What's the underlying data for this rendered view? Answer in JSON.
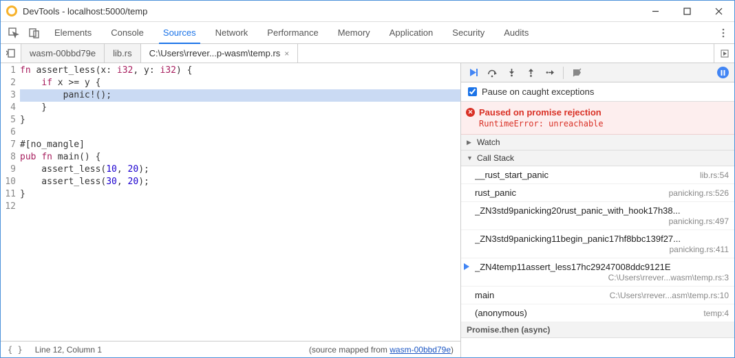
{
  "window": {
    "title": "DevTools - localhost:5000/temp"
  },
  "main_tabs": [
    "Elements",
    "Console",
    "Sources",
    "Network",
    "Performance",
    "Memory",
    "Application",
    "Security",
    "Audits"
  ],
  "main_tab_active": 2,
  "file_tabs": [
    {
      "label": "wasm-00bbd79e",
      "closable": false
    },
    {
      "label": "lib.rs",
      "closable": false
    },
    {
      "label": "C:\\Users\\rrever...p-wasm\\temp.rs",
      "closable": true
    }
  ],
  "file_tab_active": 2,
  "code": {
    "highlight_line": 3,
    "lines": [
      "fn assert_less(x: i32, y: i32) {",
      "    if x >= y {",
      "        panic!();",
      "    }",
      "}",
      "",
      "#[no_mangle]",
      "pub fn main() {",
      "    assert_less(10, 20);",
      "    assert_less(30, 20);",
      "}",
      ""
    ]
  },
  "status": {
    "cursor": "Line 12, Column 1",
    "map_prefix": "(source mapped from ",
    "map_link": "wasm-00bbd79e",
    "map_suffix": ")"
  },
  "debugger": {
    "pause_caught_label": "Pause on caught exceptions",
    "pause_caught_checked": true,
    "banner_title": "Paused on promise rejection",
    "banner_message": "RuntimeError: unreachable",
    "watch_label": "Watch",
    "callstack_label": "Call Stack",
    "async_label": "Promise.then (async)",
    "stack": [
      {
        "name": "__rust_start_panic",
        "loc": "lib.rs:54"
      },
      {
        "name": "rust_panic",
        "loc": "panicking.rs:526"
      },
      {
        "name": "_ZN3std9panicking20rust_panic_with_hook17h38...",
        "loc2": "panicking.rs:497"
      },
      {
        "name": "_ZN3std9panicking11begin_panic17hf8bbc139f27...",
        "loc2": "panicking.rs:411"
      },
      {
        "name": "_ZN4temp11assert_less17hc29247008ddc9121E",
        "loc2": "C:\\Users\\rrever...wasm\\temp.rs:3",
        "current": true
      },
      {
        "name": "main",
        "loc": "C:\\Users\\rrever...asm\\temp.rs:10"
      },
      {
        "name": "(anonymous)",
        "loc": "temp:4"
      }
    ]
  }
}
